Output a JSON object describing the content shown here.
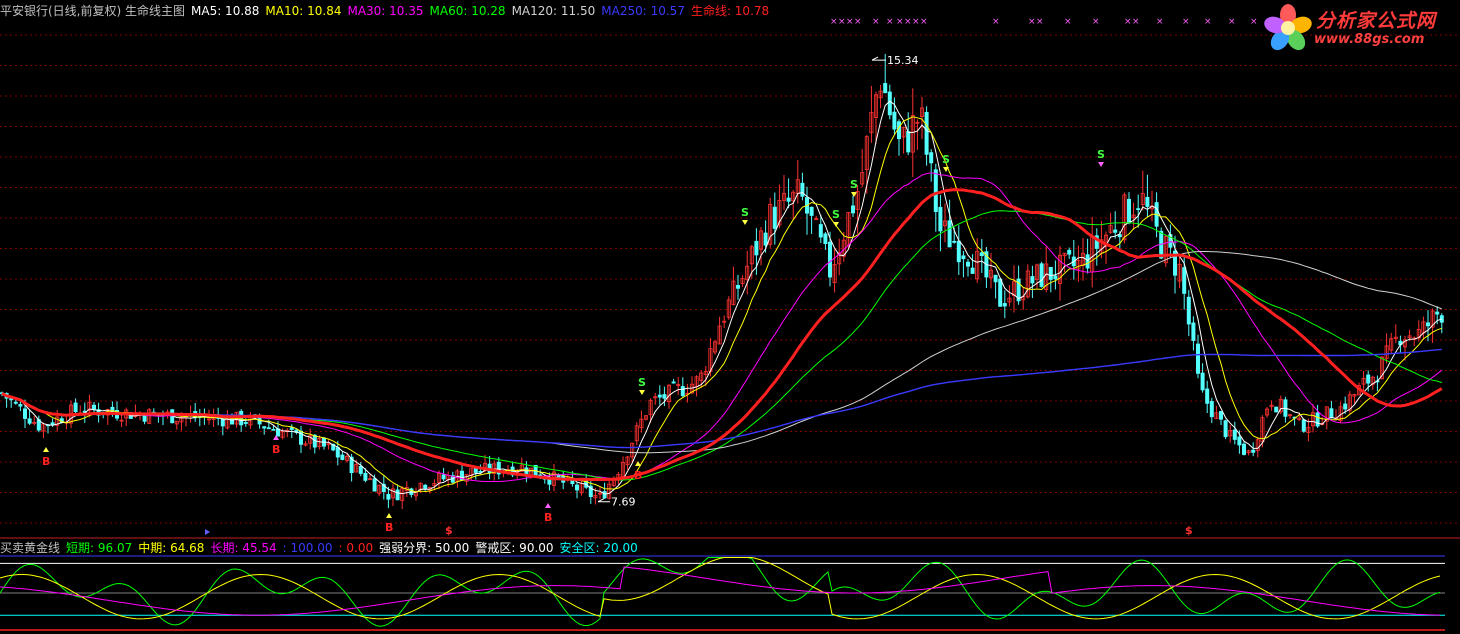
{
  "main_legend": [
    {
      "text": "平安银行(日线,前复权) 生命线主图",
      "color": "#c0c0c0"
    },
    {
      "text": "MA5: 10.88",
      "color": "#ffffff"
    },
    {
      "text": "MA10: 10.84",
      "color": "#ffff00"
    },
    {
      "text": "MA30: 10.35",
      "color": "#ff00ff"
    },
    {
      "text": "MA60: 10.28",
      "color": "#00ff00"
    },
    {
      "text": "MA120: 11.50",
      "color": "#d0d0d0"
    },
    {
      "text": "MA250: 10.57",
      "color": "#3a3aff"
    },
    {
      "text": "生命线: 10.78",
      "color": "#ff2020"
    }
  ],
  "sub_legend": [
    {
      "text": "买卖黄金线",
      "color": "#c0c0c0"
    },
    {
      "text": "短期: 96.07",
      "color": "#00ff00"
    },
    {
      "text": "中期: 64.68",
      "color": "#ffff00"
    },
    {
      "text": "长期: 45.54",
      "color": "#ff00ff"
    },
    {
      "text": ": 100.00",
      "color": "#3a3aff"
    },
    {
      "text": ": 0.00",
      "color": "#ff2020"
    },
    {
      "text": "强弱分界: 50.00",
      "color": "#ffffff"
    },
    {
      "text": "警戒区: 90.00",
      "color": "#ffffff"
    },
    {
      "text": "安全区: 20.00",
      "color": "#00ffff"
    }
  ],
  "logo": {
    "name": "分析家公式网",
    "url": "www.88gs.com"
  },
  "colors": {
    "up": "#ff3232",
    "down": "#54ffff",
    "grid": "#800000",
    "ma5": "#ffffff",
    "ma10": "#ffff00",
    "ma30": "#ff00ff",
    "ma60": "#00ff00",
    "ma120": "#d0d0d0",
    "ma250": "#3a3aff",
    "lifeline": "#ff2020"
  },
  "chart_data": [
    {
      "type": "candlestick",
      "title": "平安银行(日线,前复权) 生命线主图",
      "ylim": [
        7.2,
        16.0
      ],
      "grid": true,
      "annotations": [
        {
          "label": "15.34",
          "kind": "high_marker",
          "value": 15.34
        },
        {
          "label": "7.69",
          "kind": "low_marker",
          "value": 7.69
        },
        {
          "label": "B",
          "kind": "buy_signal"
        },
        {
          "label": "S",
          "kind": "sell_signal"
        },
        {
          "label": "$",
          "kind": "dollar_signal"
        }
      ],
      "price_path": [
        [
          0,
          9.6
        ],
        [
          40,
          9.0
        ],
        [
          80,
          9.3
        ],
        [
          150,
          9.2
        ],
        [
          250,
          9.1
        ],
        [
          330,
          8.6
        ],
        [
          390,
          7.8
        ],
        [
          420,
          8.0
        ],
        [
          470,
          8.2
        ],
        [
          520,
          8.3
        ],
        [
          560,
          8.05
        ],
        [
          600,
          7.75
        ],
        [
          620,
          8.3
        ],
        [
          650,
          9.4
        ],
        [
          700,
          9.8
        ],
        [
          720,
          10.8
        ],
        [
          740,
          11.5
        ],
        [
          770,
          12.6
        ],
        [
          800,
          13.0
        ],
        [
          830,
          11.7
        ],
        [
          860,
          13.2
        ],
        [
          880,
          15.1
        ],
        [
          900,
          13.8
        ],
        [
          920,
          14.4
        ],
        [
          940,
          12.4
        ],
        [
          970,
          12.0
        ],
        [
          1000,
          11.2
        ],
        [
          1040,
          11.6
        ],
        [
          1080,
          11.8
        ],
        [
          1110,
          12.4
        ],
        [
          1140,
          13.0
        ],
        [
          1160,
          12.2
        ],
        [
          1180,
          11.7
        ],
        [
          1200,
          9.6
        ],
        [
          1230,
          8.8
        ],
        [
          1250,
          8.5
        ],
        [
          1270,
          9.5
        ],
        [
          1300,
          9.0
        ],
        [
          1340,
          9.3
        ],
        [
          1380,
          10.0
        ],
        [
          1400,
          10.6
        ],
        [
          1420,
          10.6
        ],
        [
          1440,
          11.0
        ]
      ]
    },
    {
      "type": "line",
      "title": "买卖黄金线",
      "ylim": [
        0,
        100
      ],
      "reference_lines": [
        {
          "name": "强弱分界",
          "value": 50
        },
        {
          "name": "警戒区",
          "value": 90
        },
        {
          "name": "安全区",
          "value": 20
        }
      ],
      "series": [
        {
          "name": "短期",
          "last": 96.07
        },
        {
          "name": "中期",
          "last": 64.68
        },
        {
          "name": "长期",
          "last": 45.54
        }
      ]
    }
  ]
}
